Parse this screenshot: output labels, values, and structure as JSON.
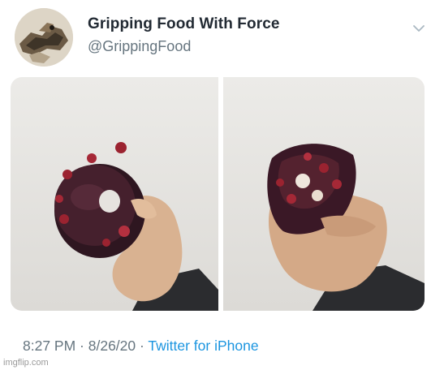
{
  "tweet": {
    "display_name": "Gripping Food With Force",
    "handle": "@GrippingFood",
    "time": "8:27 PM",
    "date": "8/26/20",
    "separator": " · ",
    "source": "Twitter for iPhone"
  },
  "icons": {
    "more": "chevron-down-icon",
    "avatar": "avatar"
  },
  "watermark": "imgflip.com",
  "colors": {
    "name": "#222a33",
    "secondary": "#66757f",
    "link": "#1b95e0"
  }
}
